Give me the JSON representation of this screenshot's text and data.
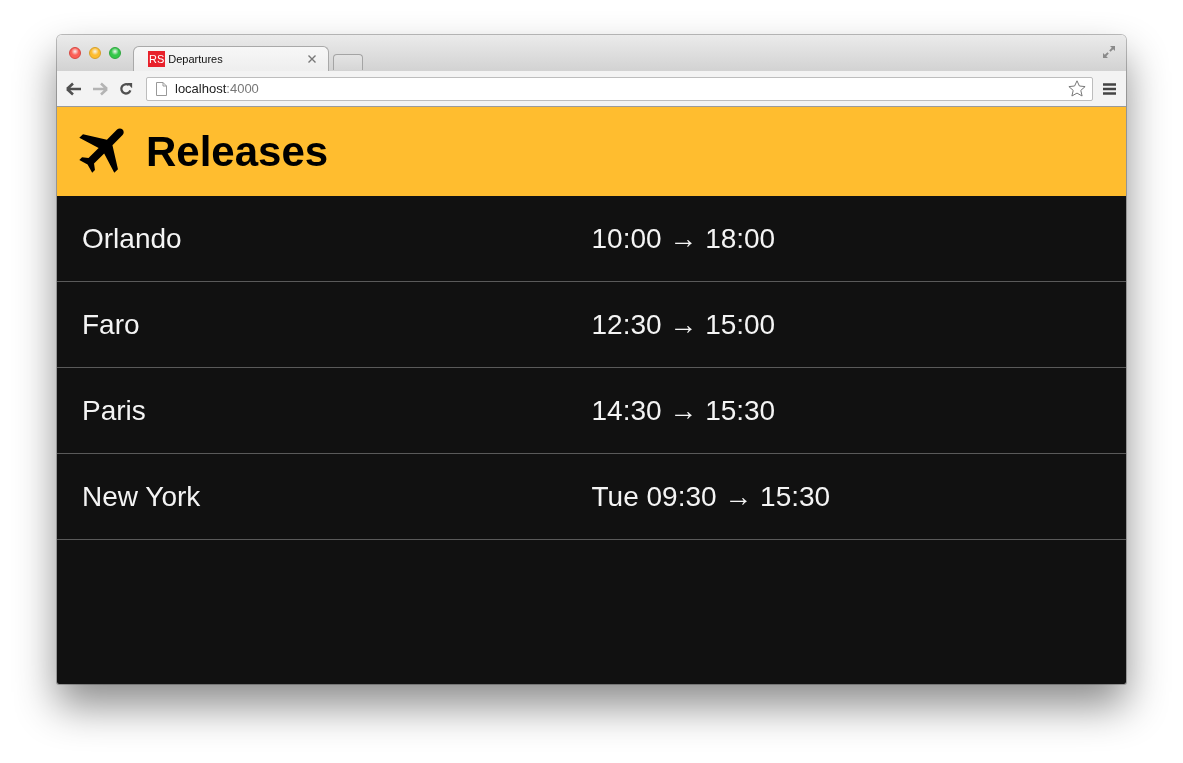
{
  "browser": {
    "tabs": [
      {
        "favicon": "RS",
        "title": "Departures",
        "selected": true
      }
    ],
    "back": {
      "disabled": false
    },
    "forward": {
      "disabled": true
    },
    "address": {
      "host": "localhost",
      "port": ":4000"
    }
  },
  "header": {
    "title": "Releases"
  },
  "departures": [
    {
      "destination": "Orlando",
      "time": "10:00 → 18:00"
    },
    {
      "destination": "Faro",
      "time": "12:30 → 15:00"
    },
    {
      "destination": "Paris",
      "time": "14:30 → 15:30"
    },
    {
      "destination": "New York",
      "time": "Tue 09:30 → 15:30"
    }
  ]
}
